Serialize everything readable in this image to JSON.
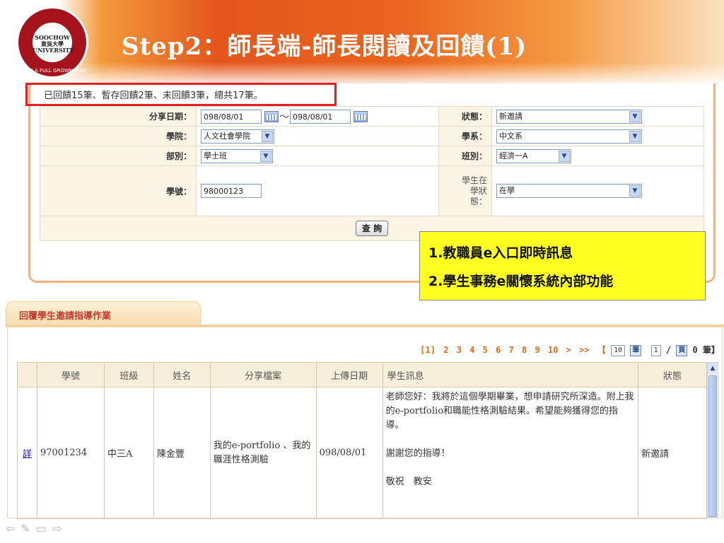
{
  "slide": {
    "title": "Step2：師長端-師長閱讀及回饋(1)",
    "logo_center": "SOOCHOW 東吳大學 UNIVERSITY",
    "logo_ring": "UNTO A FULL GROWN MAN"
  },
  "summary": {
    "text": "已回饋15筆、暫存回饋2筆、未回饋3筆，總共17筆。"
  },
  "form": {
    "share_date_label": "分享日期：",
    "date_from": "098/08/01",
    "date_to": "098/08/01",
    "date_sep": "～",
    "status_label": "狀態：",
    "status_value": "新邀請",
    "college_label": "學院",
    "college_value": "人文社會學院",
    "dept_label": "學系",
    "dept_value": "中文系",
    "division_label": "部別：",
    "division_value": "學士班",
    "class_label": "班別",
    "class_value": "經濟一A",
    "student_no_label": "學號：",
    "student_no_value": "98000123",
    "enroll_label_1": "學生在",
    "enroll_label_2": "學狀",
    "enroll_label_3": "態：",
    "enroll_value": "在學",
    "colon_red": "：",
    "query_button": "查 詢"
  },
  "callout": {
    "line1": "1.教職員e入口即時訊息",
    "line2": "2.學生事務e關懷系統內部功能"
  },
  "tab": {
    "label": "回覆學生邀請指導作業"
  },
  "pager": {
    "current": "[1]",
    "pages": [
      "2",
      "3",
      "4",
      "5",
      "6",
      "7",
      "8",
      "9",
      "10"
    ],
    "next": ">",
    "last": ">>",
    "open_bracket": "【",
    "page_size": "10",
    "unit_btn": "筆",
    "page_no": "1",
    "slash": "/",
    "page_btn": "頁",
    "total": "0 筆】"
  },
  "grid": {
    "headers": [
      "",
      "學號",
      "班級",
      "姓名",
      "分享檔案",
      "上傳日期",
      "學生訊息",
      "狀態"
    ],
    "rows": [
      {
        "detail": "詳",
        "student_no": "97001234",
        "class": "中三A",
        "name": "陳金豐",
        "file": "我的e-portfolio 、我的職涯性格測驗",
        "upload_date": "098/08/01",
        "message_1": "老師您好：我將於這個學期畢業，想申請研究所深造。附上我的e-portfolio和職能性格測驗結果。希望能夠獲得您的指導。",
        "message_2": "謝謝您的指導！",
        "message_3": "敬祝　教安",
        "status": "新邀請"
      }
    ]
  },
  "nav": {
    "prev_icon": "⇦",
    "pen_icon": "✎",
    "menu_icon": "▭",
    "next_icon": "⇨"
  },
  "colors": {
    "banner_orange": "#e4561c",
    "highlight_red": "#e41e23",
    "callout_yellow": "#ffff22",
    "tab_text": "#c0392b",
    "pager_orange": "#e4661a"
  }
}
